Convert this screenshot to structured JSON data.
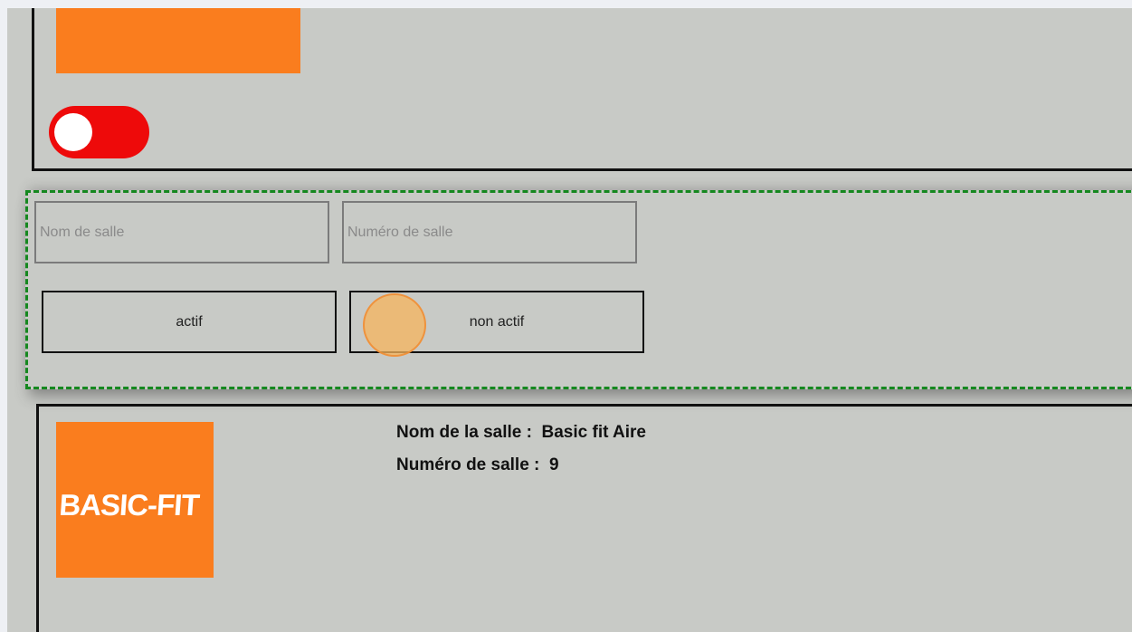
{
  "toggle": {
    "state": "off",
    "color": "#ee0a0a"
  },
  "filters": {
    "name_input": {
      "placeholder": "Nom de salle",
      "value": ""
    },
    "number_input": {
      "placeholder": "Numéro de salle",
      "value": ""
    },
    "active_button": {
      "label": "actif"
    },
    "inactive_button": {
      "label": "non actif"
    }
  },
  "result": {
    "logo_text": "BASIC-FIT",
    "name_label": "Nom de la salle :",
    "name_value": "Basic fit Aire",
    "number_label": "Numéro de salle :",
    "number_value": "9"
  },
  "colors": {
    "accent": "#fa7d1e",
    "panel_border": "#15881f",
    "background": "#c8cac6"
  }
}
